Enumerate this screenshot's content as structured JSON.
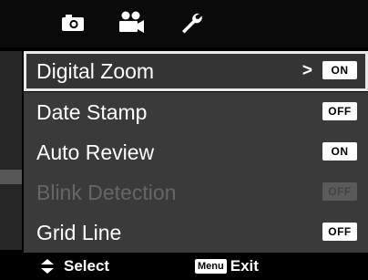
{
  "tabs": [
    {
      "icon": "camera-icon"
    },
    {
      "icon": "video-camera-icon"
    },
    {
      "icon": "wrench-icon"
    }
  ],
  "menu": {
    "items": [
      {
        "label": "Digital Zoom",
        "value": "ON",
        "selected": true,
        "enabled": true
      },
      {
        "label": "Date Stamp",
        "value": "OFF",
        "selected": false,
        "enabled": true
      },
      {
        "label": "Auto Review",
        "value": "ON",
        "selected": false,
        "enabled": true
      },
      {
        "label": "Blink Detection",
        "value": "OFF",
        "selected": false,
        "enabled": false
      },
      {
        "label": "Grid Line",
        "value": "OFF",
        "selected": false,
        "enabled": true
      }
    ],
    "arrow": ">"
  },
  "footer": {
    "select_label": "Select",
    "menu_key": "Menu",
    "exit_label": "Exit"
  }
}
